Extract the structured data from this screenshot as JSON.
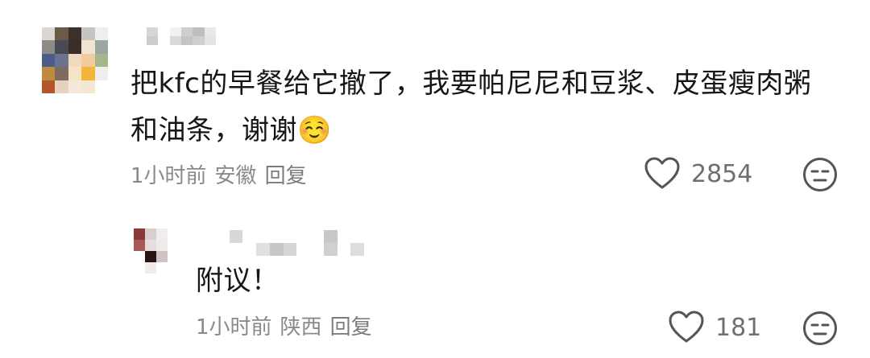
{
  "colors": {
    "text": "#161616",
    "meta": "#8a8a8a",
    "icon": "#555555",
    "background": "#ffffff"
  },
  "comments": [
    {
      "text_line1": "把kfc的早餐给它撤了，我要帕尼尼和豆浆、皮蛋瘦肉粥",
      "text_line2": "和油条，谢谢☺️",
      "time": "1小时前",
      "location": "安徽",
      "reply_label": "回复",
      "likes": "2854",
      "like_icon": "heart-outline-icon",
      "dislike_icon": "neutral-face-icon"
    }
  ],
  "replies": [
    {
      "text": "附议！",
      "time": "1小时前",
      "location": "陕西",
      "reply_label": "回复",
      "likes": "181",
      "like_icon": "heart-outline-icon",
      "dislike_icon": "neutral-face-icon"
    }
  ]
}
